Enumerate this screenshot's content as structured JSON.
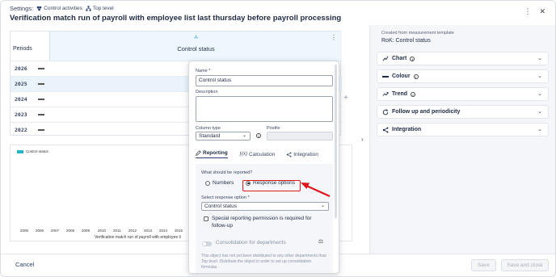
{
  "header": {
    "settings_label": "Settings:",
    "crumbs": [
      "Control activities",
      "Top level"
    ],
    "title": "Verification match run of payroll with employee list last thursday before payroll processing",
    "kebab": "⋮",
    "close": "✕"
  },
  "grid": {
    "periods_label": "Periods",
    "column_letter": "A",
    "column_name": "Control status",
    "years": [
      "2026",
      "2025",
      "2024",
      "2023",
      "2022"
    ]
  },
  "chart": {
    "legend": "Control status",
    "x_ticks": [
      "2005",
      "2006",
      "2007",
      "2008",
      "2009",
      "2010",
      "2011",
      "2012",
      "2013",
      "2014",
      "2015",
      "2016"
    ],
    "x_label": "Verification match run of payroll with employee li"
  },
  "popover": {
    "name_label": "Name *",
    "name_value": "Control status",
    "description_label": "Description",
    "column_type_label": "Column type",
    "column_type_value": "Standard",
    "postfix_label": "Postfix",
    "tabs": [
      "Reporting",
      "Calculation",
      "Integration"
    ],
    "report_question": "What should be reported?",
    "option_numbers": "Numbers",
    "option_response": "Response options",
    "select_label": "Select response option *",
    "select_value": "Control status",
    "special_permission": "Special reporting permission is required for follow-up",
    "consolidation": "Consolidation for departments",
    "note": "This object has not yet been distributed to any other departments than Top level. Distribute the object in order to set up consolidation formulas."
  },
  "right_panel": {
    "source": "Created from measurement template",
    "template": "RoK: Control status",
    "sections": [
      "Chart",
      "Colour",
      "Trend",
      "Follow up and periodicity",
      "Integration"
    ]
  },
  "footer": {
    "cancel": "Cancel",
    "save": "Save",
    "save_close": "Save and close"
  },
  "colors": {
    "accent": "#2a3f6b",
    "highlight": "#e0141b",
    "legend": "#26b5c5"
  }
}
